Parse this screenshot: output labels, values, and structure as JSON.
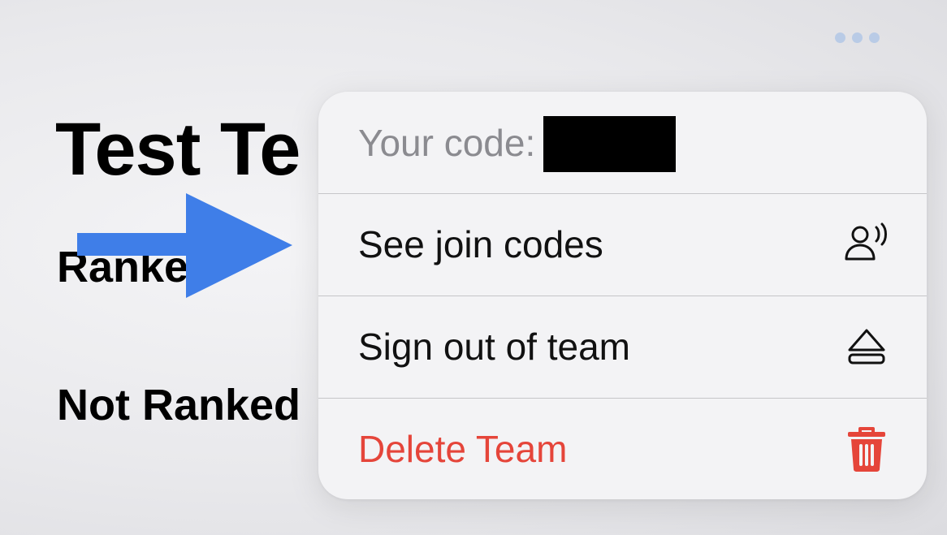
{
  "header": {
    "more_icon": "ellipsis-icon"
  },
  "page": {
    "title": "Test Te",
    "ranked_heading": "Ranke",
    "not_ranked_heading": "Not Ranked"
  },
  "menu": {
    "code_label": "Your code:",
    "items": [
      {
        "label": "See join codes",
        "icon": "person-wave-icon"
      },
      {
        "label": "Sign out of team",
        "icon": "eject-icon"
      },
      {
        "label": "Delete Team",
        "icon": "trash-icon",
        "destructive": true
      }
    ]
  },
  "colors": {
    "destructive": "#e5453a",
    "arrow": "#3f7ee8",
    "more_dots": "#b9cbe6"
  }
}
